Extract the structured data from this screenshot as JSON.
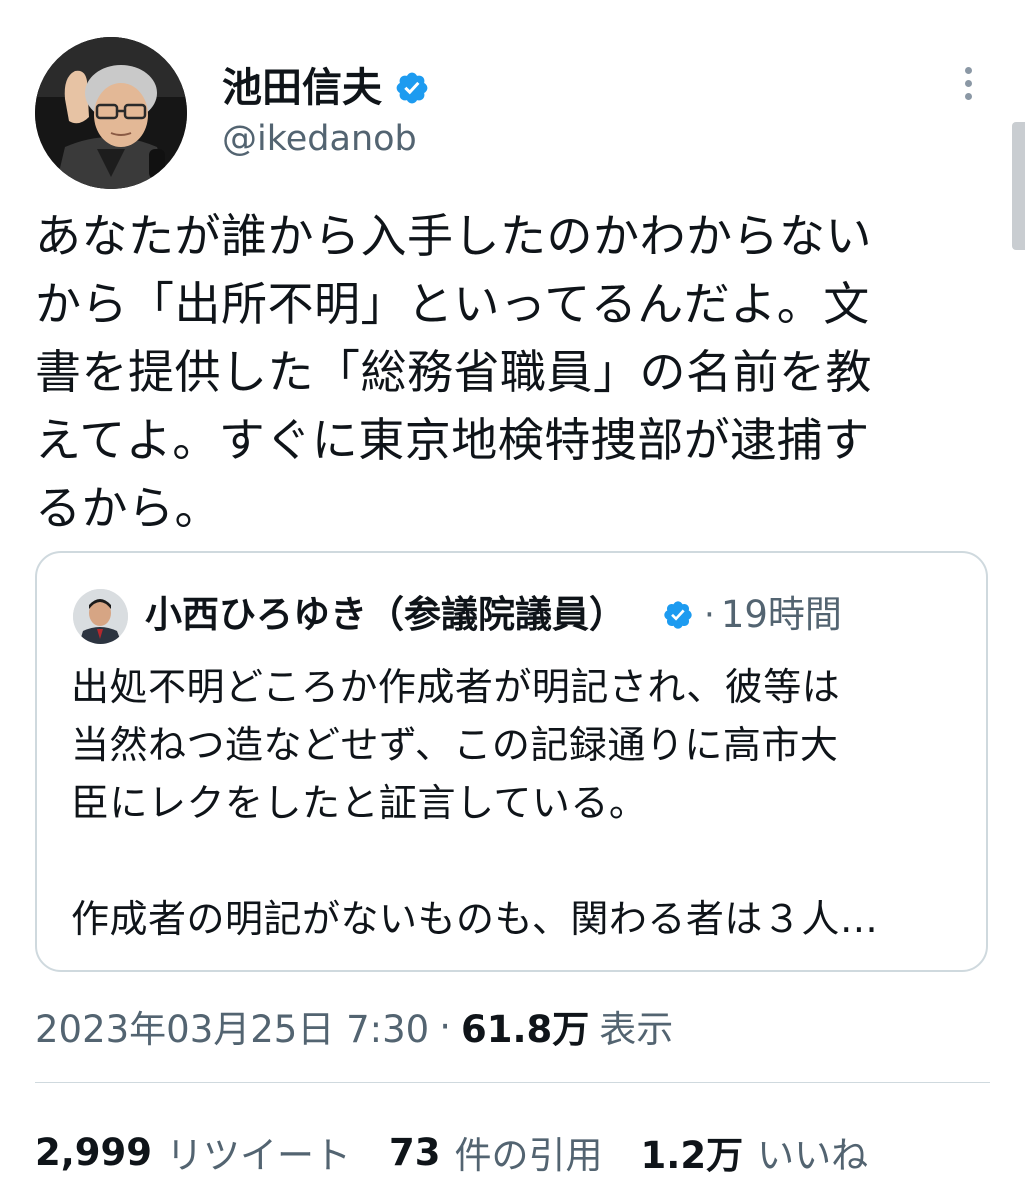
{
  "author": {
    "name": "池田信夫",
    "handle": "@ikedanob",
    "verified": true
  },
  "tweet": {
    "text": "あなたが誰から入手したのかわからない\nから「出所不明」といってるんだよ。文\n書を提供した「総務省職員」の名前を教\nえてよ。すぐに東京地検特捜部が逮捕す\nるから。"
  },
  "quote": {
    "author_name": "小西ひろゆき（参議院議員）",
    "verified": true,
    "separator": "·",
    "time": "19時間",
    "text": "出処不明どころか作成者が明記され、彼等は\n当然ねつ造などせず、この記録通りに高市大\n臣にレクをしたと証言している。\n\n作成者の明記がないものも、関わる者は３人…"
  },
  "meta": {
    "timestamp": "2023年03月25日 7:30",
    "separator": "·",
    "views_count": "61.8万",
    "views_label": "表示"
  },
  "stats": [
    {
      "count": "2,999",
      "label": "リツイート"
    },
    {
      "count": "73",
      "label": "件の引用"
    },
    {
      "count": "1.2万",
      "label": "いいね"
    }
  ],
  "colors": {
    "text_primary": "#0f1419",
    "text_secondary": "#536471",
    "verified_badge": "#1d9bf0",
    "border": "#cfd9de"
  },
  "icons": {
    "verified": "verified-badge-icon",
    "more": "more-options-icon"
  }
}
